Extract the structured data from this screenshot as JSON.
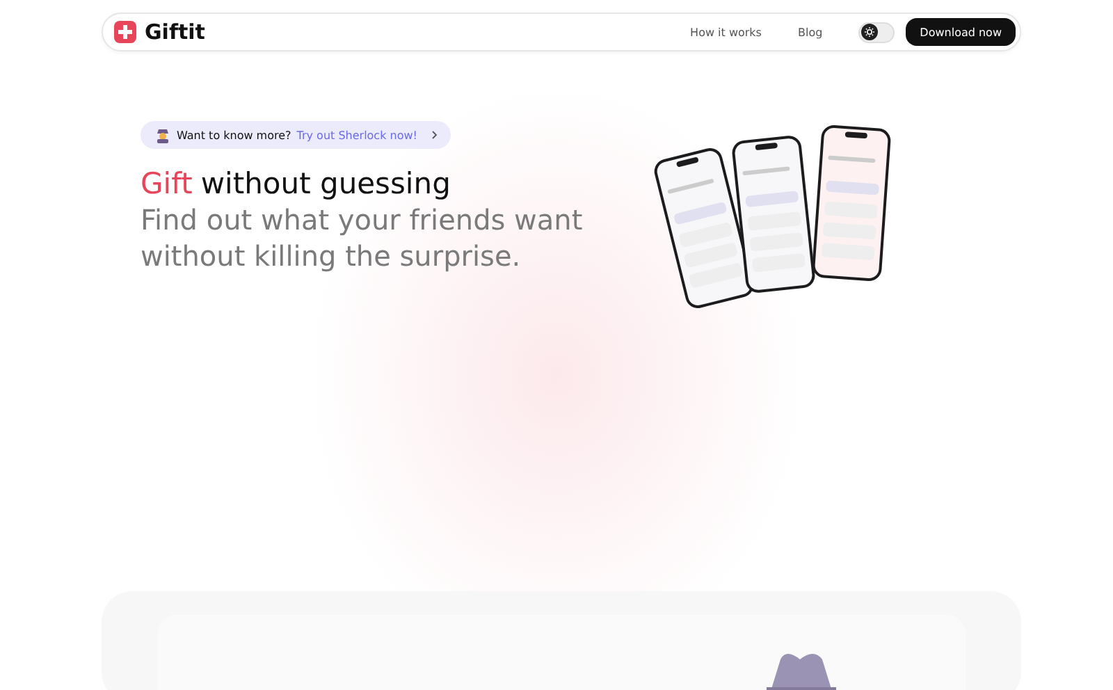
{
  "nav": {
    "brand": "Giftit",
    "links": [
      "How it works",
      "Blog"
    ],
    "theme_toggle": {
      "on": false
    },
    "cta": "Download now"
  },
  "hero": {
    "badge": {
      "text": "Want to know more?",
      "link": "Try out Sherlock now!"
    },
    "title_highlight": "Gift",
    "title_rest": "without guessing",
    "subtitle": "Find out what your friends want without killing the surprise."
  }
}
